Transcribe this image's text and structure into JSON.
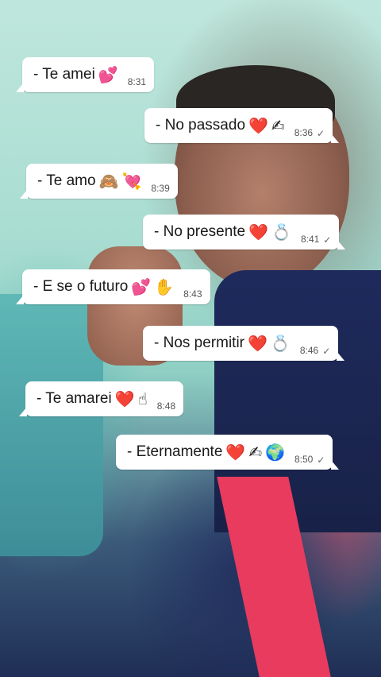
{
  "messages": [
    {
      "direction": "in",
      "text": "- Te amei",
      "emojis": [
        "💕"
      ],
      "time": "8:31",
      "tick": ""
    },
    {
      "direction": "out",
      "text": "- No passado",
      "emojis": [
        "❤️",
        "✍"
      ],
      "time": "8:36",
      "tick": "✓"
    },
    {
      "direction": "in",
      "text": "- Te amo",
      "emojis": [
        "🙈",
        "💘"
      ],
      "time": "8:39",
      "tick": ""
    },
    {
      "direction": "out",
      "text": "- No presente",
      "emojis": [
        "❤️",
        "💍"
      ],
      "time": "8:41",
      "tick": "✓"
    },
    {
      "direction": "in",
      "text": "- E se o futuro",
      "emojis": [
        "💕",
        "✋"
      ],
      "time": "8:43",
      "tick": ""
    },
    {
      "direction": "out",
      "text": "- Nos permitir",
      "emojis": [
        "❤️",
        "💍"
      ],
      "time": "8:46",
      "tick": "✓"
    },
    {
      "direction": "in",
      "text": "- Te amarei",
      "emojis": [
        "❤️",
        "☝"
      ],
      "time": "8:48",
      "tick": ""
    },
    {
      "direction": "out",
      "text": "- Eternamente",
      "emojis": [
        "❤️",
        "✍",
        "🌍"
      ],
      "time": "8:50",
      "tick": "✓"
    }
  ],
  "colors": {
    "bubble": "#ffffff",
    "text": "#1a1a1a",
    "time": "#555555"
  }
}
